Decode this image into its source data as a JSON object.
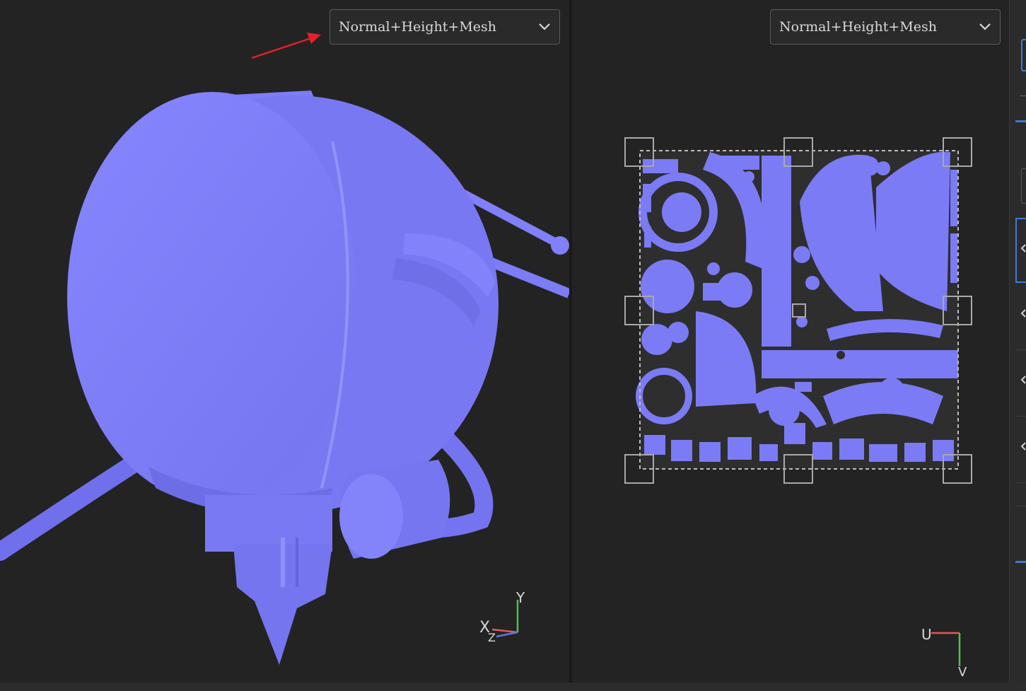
{
  "viewports": {
    "left": {
      "display_mode": "Normal+Height+Mesh",
      "axis_labels": {
        "x": "X",
        "y": "Y",
        "z": "Z"
      }
    },
    "right": {
      "display_mode": "Normal+Height+Mesh",
      "axis_labels": {
        "u": "U",
        "v": "V"
      }
    }
  },
  "icons": {
    "dropdown": "chevron-down-icon",
    "annotation": "red-arrow-annotation",
    "gizmo3d": "axis-gizmo-xyz-icon",
    "gizmo2d": "axis-gizmo-uv-icon"
  },
  "colors": {
    "normal_map": "#7b7bf5",
    "annotation": "#e0212a",
    "axis_x": "#e05a5a",
    "axis_y": "#4fc04f",
    "axis_z": "#5a78e0",
    "panel_accent": "#3d7bd6"
  }
}
